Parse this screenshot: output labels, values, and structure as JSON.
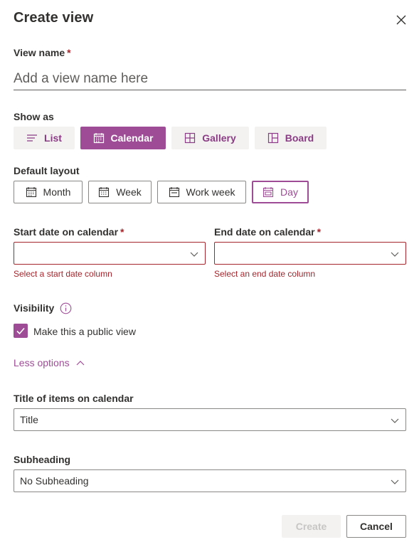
{
  "panel": {
    "title": "Create view",
    "close_icon": "close-icon"
  },
  "view_name": {
    "label": "View name",
    "required_mark": "*",
    "placeholder": "Add a view name here",
    "value": ""
  },
  "show_as": {
    "label": "Show as",
    "options": [
      {
        "label": "List",
        "icon": "list-icon",
        "selected": false
      },
      {
        "label": "Calendar",
        "icon": "calendar-icon",
        "selected": true
      },
      {
        "label": "Gallery",
        "icon": "gallery-icon",
        "selected": false
      },
      {
        "label": "Board",
        "icon": "board-icon",
        "selected": false
      }
    ]
  },
  "default_layout": {
    "label": "Default layout",
    "options": [
      {
        "label": "Month",
        "icon": "month-icon",
        "selected": false
      },
      {
        "label": "Week",
        "icon": "week-icon",
        "selected": false
      },
      {
        "label": "Work week",
        "icon": "work-week-icon",
        "selected": false
      },
      {
        "label": "Day",
        "icon": "day-icon",
        "selected": true
      }
    ]
  },
  "start_date": {
    "label": "Start date on calendar",
    "required_mark": "*",
    "value": "",
    "error": "Select a start date column"
  },
  "end_date": {
    "label": "End date on calendar",
    "required_mark": "*",
    "value": "",
    "error": "Select an end date column"
  },
  "visibility": {
    "label": "Visibility",
    "info_icon": "info-icon",
    "checkbox_label": "Make this a public view",
    "checked": true
  },
  "options_toggle": {
    "label": "Less options",
    "icon": "chevron-up-icon"
  },
  "title_of_items": {
    "label": "Title of items on calendar",
    "value": "Title"
  },
  "subheading": {
    "label": "Subheading",
    "value": "No Subheading"
  },
  "footer": {
    "create_label": "Create",
    "cancel_label": "Cancel"
  },
  "colors": {
    "accent": "#9e4c96",
    "error": "#a4262c",
    "border": "#8a8886"
  }
}
